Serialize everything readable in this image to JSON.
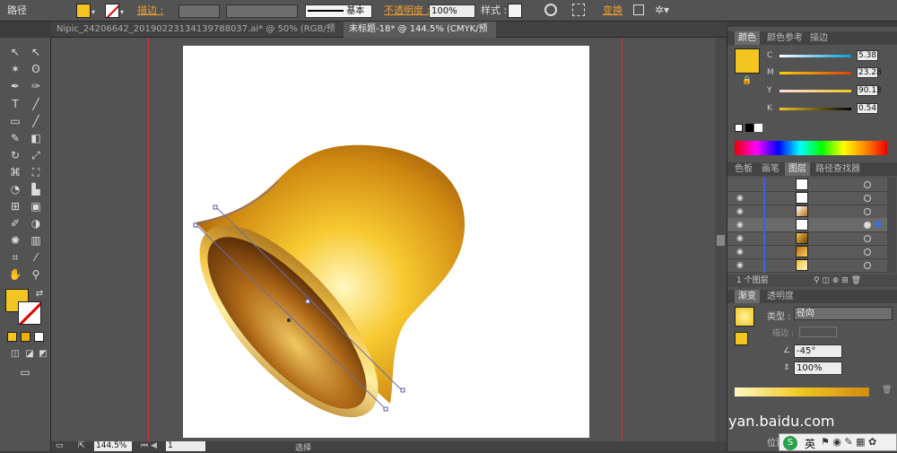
{
  "control_bar": {
    "object_type": "路径",
    "stroke_label": "描边 :",
    "stroke_style": "基本",
    "opacity_label": "不透明度 :",
    "opacity_value": "100%",
    "style_label": "样式 :",
    "transform_label": "变换",
    "fill_color": "#f2c521"
  },
  "tabs": [
    {
      "label": "Nipic_24206642_20190223134139788037.ai* @ 50% (RGB/预览)",
      "active": false
    },
    {
      "label": "未标题-18* @ 144.5% (CMYK/预览)",
      "active": true
    }
  ],
  "status_bar": {
    "zoom": "144.5%",
    "page": "1",
    "tool": "选择"
  },
  "color_panel": {
    "tabs": [
      "颜色",
      "颜色参考",
      "描边"
    ],
    "channels": [
      {
        "label": "C",
        "value": "5.38"
      },
      {
        "label": "M",
        "value": "23.28"
      },
      {
        "label": "Y",
        "value": "90.13"
      },
      {
        "label": "K",
        "value": "0.54"
      }
    ],
    "swatch": "#f2c521"
  },
  "layers_panel": {
    "tabs": [
      "色板",
      "画笔",
      "图层",
      "路径查找器"
    ],
    "footer": "1 个图层",
    "rows": 7
  },
  "gradient_panel": {
    "tabs": [
      "渐变",
      "透明度"
    ],
    "type_label": "类型 :",
    "type_value": "径向",
    "stroke_label": "描边 :",
    "angle": "-45°",
    "aspect": "100%",
    "location_label": "位置"
  },
  "watermark": "yan.baidu.com",
  "ime_label": "英"
}
